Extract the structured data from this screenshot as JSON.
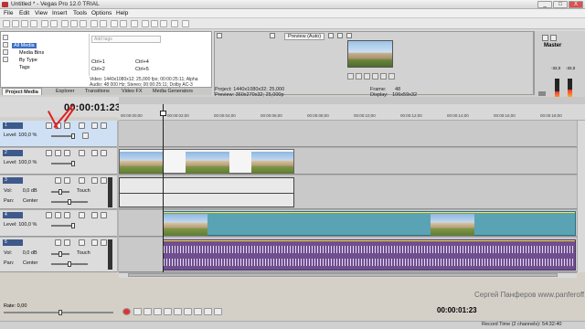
{
  "window": {
    "title": "Untitled * - Vegas Pro 12.0 TRIAL",
    "controls": [
      "_",
      "□",
      "X"
    ]
  },
  "menu": [
    "File",
    "Edit",
    "View",
    "Insert",
    "Tools",
    "Options",
    "Help"
  ],
  "explorer": {
    "tree": [
      "All Media",
      "Media Bins",
      "By Type",
      "Tags"
    ],
    "search_placeholder": "Add tags",
    "shortcuts": [
      "Ctrl+1",
      "Ctrl+2",
      "Ctrl+4",
      "Ctrl+5"
    ],
    "media_info": [
      "Video: 1440x1080x12; 25,000 fps; 00:00:25:11; Alpha",
      "Audio: 48 000 Hz; Stereo; 00:00:25:11; Dolby AC-3"
    ],
    "tabs": [
      "Project Media",
      "Explorer",
      "Transitions",
      "Video FX",
      "Media Generators"
    ],
    "active_tab": 0
  },
  "preview": {
    "mode": "Preview (Auto)",
    "project_label": "Project:",
    "project_value": "1440x1080x32; 25,000",
    "preview_label": "Preview:",
    "preview_value": "360x270x32; 25,000p",
    "frame_label": "Frame:",
    "frame_value": "48",
    "display_label": "Display:",
    "display_value": "106x59x32"
  },
  "master": {
    "title": "Master",
    "db_values": [
      "-32,0",
      "-32,0"
    ],
    "levels": [
      0.7,
      0.75
    ]
  },
  "timeline": {
    "timecode": "00:00:01:23",
    "ruler": [
      "00:00:00;00",
      "00:00:02;00",
      "00:00:04;00",
      "00:00:06;00",
      "00:00:08;00",
      "00:00:10;00",
      "00:00:12;00",
      "00:00:14;00",
      "00:00:16;00",
      "00:00:18;00"
    ],
    "tracks": [
      {
        "num": "1",
        "kind": "video",
        "level_label": "Level:",
        "level_value": "100,0 %"
      },
      {
        "num": "2",
        "kind": "video",
        "level_label": "Level:",
        "level_value": "100,0 %"
      },
      {
        "num": "3",
        "kind": "audio",
        "vol_label": "Vol:",
        "vol_value": "0,0 dB",
        "pan_label": "Pan:",
        "pan_value": "Center",
        "mode": "Touch"
      },
      {
        "num": "4",
        "kind": "video",
        "level_label": "Level:",
        "level_value": "100,0 %"
      },
      {
        "num": "5",
        "kind": "audio",
        "vol_label": "Vol:",
        "vol_value": "0,0 dB",
        "pan_label": "Pan:",
        "pan_value": "Center",
        "mode": "Touch"
      }
    ]
  },
  "bottom": {
    "rate_label": "Rate: 0,00",
    "transport_timecode": "00:00:01:23",
    "record_time": "Record Time (2 channels): 54:32:40",
    "watermark": "Сергей Панферов www.panferoff.com"
  },
  "colors": {
    "audio_clip": "#6f4f8f",
    "video_clip": "#5aa3b4",
    "track_header_blue": "#3d5a8a",
    "annotation_red": "#e02020"
  }
}
